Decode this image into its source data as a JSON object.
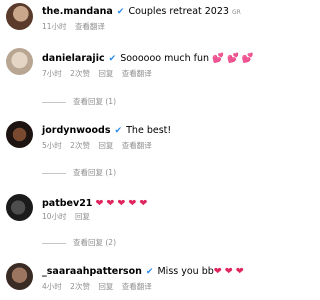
{
  "comments": [
    {
      "username": "the.mandana",
      "text": "Couples retreat 2023",
      "suffix": "GR",
      "time": "11小时",
      "translate": "查看翻译"
    },
    {
      "username": "danielarajic",
      "text": "Soooooo much fun",
      "emoji": "💕 💕 💕",
      "time": "7小时",
      "likes": "2次赞",
      "reply": "回复",
      "translate": "查看翻译",
      "view_replies": "查看回复 (1)"
    },
    {
      "username": "jordynwoods",
      "text": "The best!",
      "time": "5小时",
      "likes": "2次赞",
      "reply": "回复",
      "translate": "查看翻译",
      "view_replies": "查看回复 (1)"
    },
    {
      "username": "patbev21",
      "emoji": "❤ ❤ ❤ ❤ ❤",
      "time": "10小时",
      "reply": "回复",
      "view_replies": "查看回复 (2)"
    },
    {
      "username": "_saaraahpatterson",
      "text": "Miss you bb",
      "emoji": "❤ ❤ ❤",
      "time": "4小时",
      "likes": "2次赞",
      "reply": "回复",
      "translate": "查看翻译"
    }
  ],
  "icons": {
    "verified": "verified-badge-icon",
    "heart": "red-heart-emoji",
    "pink_hearts": "two-hearts-emoji"
  },
  "colors": {
    "verified": "#2b8bf2",
    "meta": "#8e8e8e",
    "heart": "#e0245e"
  }
}
